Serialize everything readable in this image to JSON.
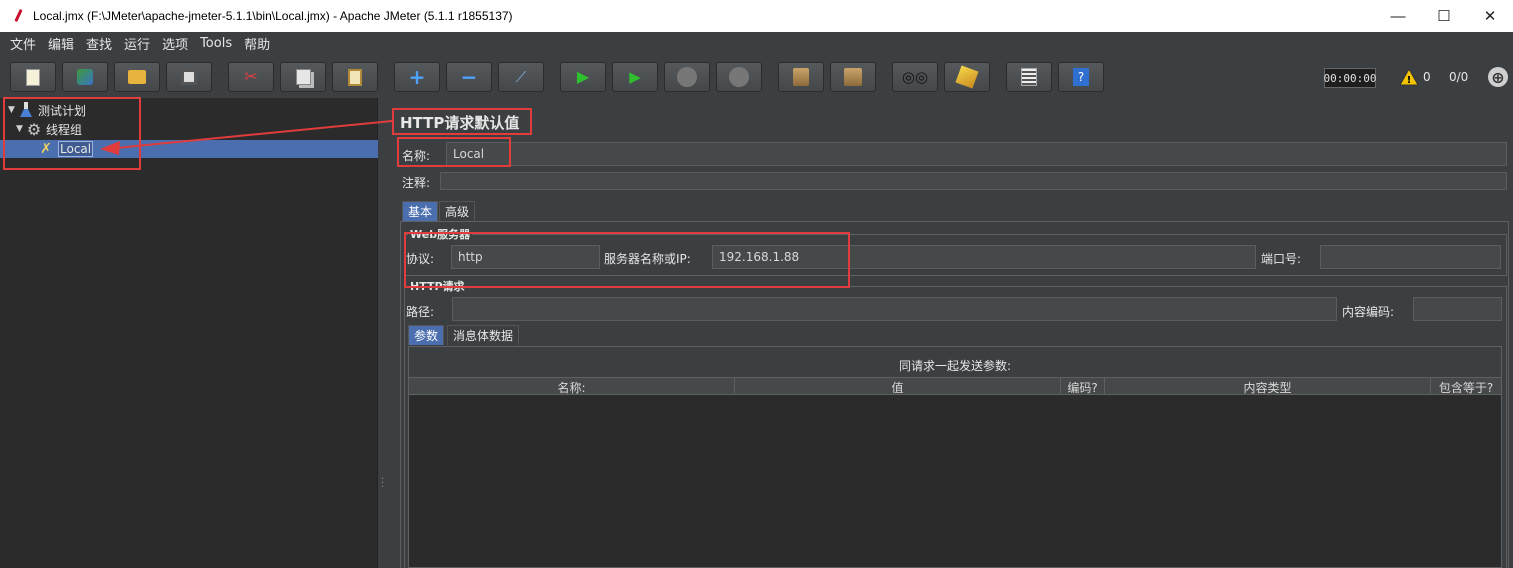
{
  "window": {
    "title": "Local.jmx (F:\\JMeter\\apache-jmeter-5.1.1\\bin\\Local.jmx) - Apache JMeter (5.1.1 r1855137)",
    "minimize": "—",
    "maximize": "☐",
    "close": "✕"
  },
  "menu": [
    "文件",
    "编辑",
    "查找",
    "运行",
    "选项",
    "Tools",
    "帮助"
  ],
  "toolbar": {
    "icons": [
      "new-icon",
      "templates-icon",
      "open-icon",
      "save-icon",
      "cut-icon",
      "copy-icon",
      "paste-icon",
      "expand-icon",
      "collapse-icon",
      "toggle-icon",
      "start-icon",
      "start-no-timers-icon",
      "stop-icon",
      "shutdown-icon",
      "clear-icon",
      "clear-all-icon",
      "search-icon",
      "reset-search-icon",
      "function-helper-icon",
      "help-icon"
    ],
    "timer": "00:00:00",
    "warning_count": "0",
    "thread_count": "0/0"
  },
  "tree": {
    "items": [
      {
        "label": "测试计划",
        "icon": "flask-icon"
      },
      {
        "label": "线程组",
        "icon": "gear-icon"
      },
      {
        "label": "Local",
        "icon": "tools-icon"
      }
    ]
  },
  "panel": {
    "title": "HTTP请求默认值",
    "name_label": "名称:",
    "name_value": "Local",
    "comment_label": "注释:",
    "comment_value": "",
    "tabs": [
      "基本",
      "高级"
    ],
    "web_server": {
      "title": "Web服务器",
      "protocol_label": "协议:",
      "protocol_value": "http",
      "server_label": "服务器名称或IP:",
      "server_value": "192.168.1.88",
      "port_label": "端口号:",
      "port_value": ""
    },
    "http_request": {
      "title": "HTTP请求",
      "path_label": "路径:",
      "path_value": "",
      "encoding_label": "内容编码:",
      "encoding_value": ""
    },
    "sub_tabs": [
      "参数",
      "消息体数据"
    ],
    "table": {
      "caption": "同请求一起发送参数:",
      "columns": [
        "名称:",
        "值",
        "编码?",
        "内容类型",
        "包含等于?"
      ]
    }
  },
  "colors": {
    "annotation": "#e03c3c",
    "selection": "#4b6eaf",
    "background": "#3c3f41"
  }
}
